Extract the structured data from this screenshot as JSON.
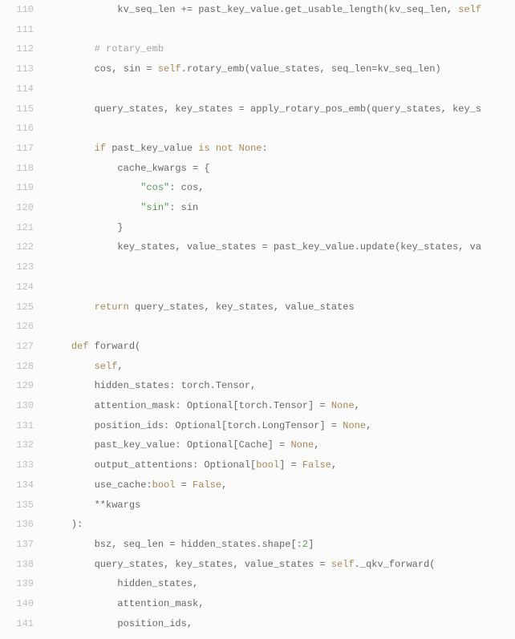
{
  "chart_data": null,
  "lines": [
    {
      "n": "110",
      "indent": "            ",
      "tokens": [
        {
          "t": "kv_seq_len += past_key_value.get_usable_length(kv_seq_len, "
        },
        {
          "t": "self",
          "c": "self"
        }
      ]
    },
    {
      "n": "111",
      "indent": "",
      "tokens": []
    },
    {
      "n": "112",
      "indent": "        ",
      "tokens": [
        {
          "t": "# rotary_emb",
          "c": "comment"
        }
      ]
    },
    {
      "n": "113",
      "indent": "        ",
      "tokens": [
        {
          "t": "cos, sin = "
        },
        {
          "t": "self",
          "c": "self"
        },
        {
          "t": ".rotary_emb(value_states, seq_len=kv_seq_len)"
        }
      ]
    },
    {
      "n": "114",
      "indent": "",
      "tokens": []
    },
    {
      "n": "115",
      "indent": "        ",
      "tokens": [
        {
          "t": "query_states, key_states = apply_rotary_pos_emb(query_states, key_s"
        }
      ]
    },
    {
      "n": "116",
      "indent": "",
      "tokens": []
    },
    {
      "n": "117",
      "indent": "        ",
      "tokens": [
        {
          "t": "if ",
          "c": "kw"
        },
        {
          "t": "past_key_value "
        },
        {
          "t": "is not ",
          "c": "kw"
        },
        {
          "t": "None",
          "c": "const"
        },
        {
          "t": ":"
        }
      ]
    },
    {
      "n": "118",
      "indent": "            ",
      "tokens": [
        {
          "t": "cache_kwargs = {"
        }
      ]
    },
    {
      "n": "119",
      "indent": "                ",
      "tokens": [
        {
          "t": "\"cos\"",
          "c": "str"
        },
        {
          "t": ": cos,"
        }
      ]
    },
    {
      "n": "120",
      "indent": "                ",
      "tokens": [
        {
          "t": "\"sin\"",
          "c": "str"
        },
        {
          "t": ": sin"
        }
      ]
    },
    {
      "n": "121",
      "indent": "            ",
      "tokens": [
        {
          "t": "}"
        }
      ]
    },
    {
      "n": "122",
      "indent": "            ",
      "tokens": [
        {
          "t": "key_states, value_states = past_key_value.update(key_states, va"
        }
      ]
    },
    {
      "n": "123",
      "indent": "",
      "tokens": []
    },
    {
      "n": "124",
      "indent": "",
      "tokens": []
    },
    {
      "n": "125",
      "indent": "        ",
      "tokens": [
        {
          "t": "return ",
          "c": "kw"
        },
        {
          "t": "query_states, key_states, value_states"
        }
      ]
    },
    {
      "n": "126",
      "indent": "",
      "tokens": []
    },
    {
      "n": "127",
      "indent": "    ",
      "tokens": [
        {
          "t": "def ",
          "c": "kw"
        },
        {
          "t": "forward("
        }
      ]
    },
    {
      "n": "128",
      "indent": "        ",
      "tokens": [
        {
          "t": "self",
          "c": "self"
        },
        {
          "t": ","
        }
      ]
    },
    {
      "n": "129",
      "indent": "        ",
      "tokens": [
        {
          "t": "hidden_states: torch.Tensor,"
        }
      ]
    },
    {
      "n": "130",
      "indent": "        ",
      "tokens": [
        {
          "t": "attention_mask: Optional[torch.Tensor] = "
        },
        {
          "t": "None",
          "c": "const"
        },
        {
          "t": ","
        }
      ]
    },
    {
      "n": "131",
      "indent": "        ",
      "tokens": [
        {
          "t": "position_ids: Optional[torch.LongTensor] = "
        },
        {
          "t": "None",
          "c": "const"
        },
        {
          "t": ","
        }
      ]
    },
    {
      "n": "132",
      "indent": "        ",
      "tokens": [
        {
          "t": "past_key_value: Optional[Cache] = "
        },
        {
          "t": "None",
          "c": "const"
        },
        {
          "t": ","
        }
      ]
    },
    {
      "n": "133",
      "indent": "        ",
      "tokens": [
        {
          "t": "output_attentions: Optional["
        },
        {
          "t": "bool",
          "c": "type"
        },
        {
          "t": "] = "
        },
        {
          "t": "False",
          "c": "const"
        },
        {
          "t": ","
        }
      ]
    },
    {
      "n": "134",
      "indent": "        ",
      "tokens": [
        {
          "t": "use_cache:"
        },
        {
          "t": "bool",
          "c": "type"
        },
        {
          "t": " = "
        },
        {
          "t": "False",
          "c": "const"
        },
        {
          "t": ","
        }
      ]
    },
    {
      "n": "135",
      "indent": "        ",
      "tokens": [
        {
          "t": "**kwargs"
        }
      ]
    },
    {
      "n": "136",
      "indent": "    ",
      "tokens": [
        {
          "t": "):"
        }
      ]
    },
    {
      "n": "137",
      "indent": "        ",
      "tokens": [
        {
          "t": "bsz, seq_len = hidden_states.shape[:"
        },
        {
          "t": "2",
          "c": "num"
        },
        {
          "t": "]"
        }
      ]
    },
    {
      "n": "138",
      "indent": "        ",
      "tokens": [
        {
          "t": "query_states, key_states, value_states = "
        },
        {
          "t": "self",
          "c": "self"
        },
        {
          "t": "._qkv_forward("
        }
      ]
    },
    {
      "n": "139",
      "indent": "            ",
      "tokens": [
        {
          "t": "hidden_states,"
        }
      ]
    },
    {
      "n": "140",
      "indent": "            ",
      "tokens": [
        {
          "t": "attention_mask,"
        }
      ]
    },
    {
      "n": "141",
      "indent": "            ",
      "tokens": [
        {
          "t": "position_ids,"
        }
      ]
    }
  ]
}
